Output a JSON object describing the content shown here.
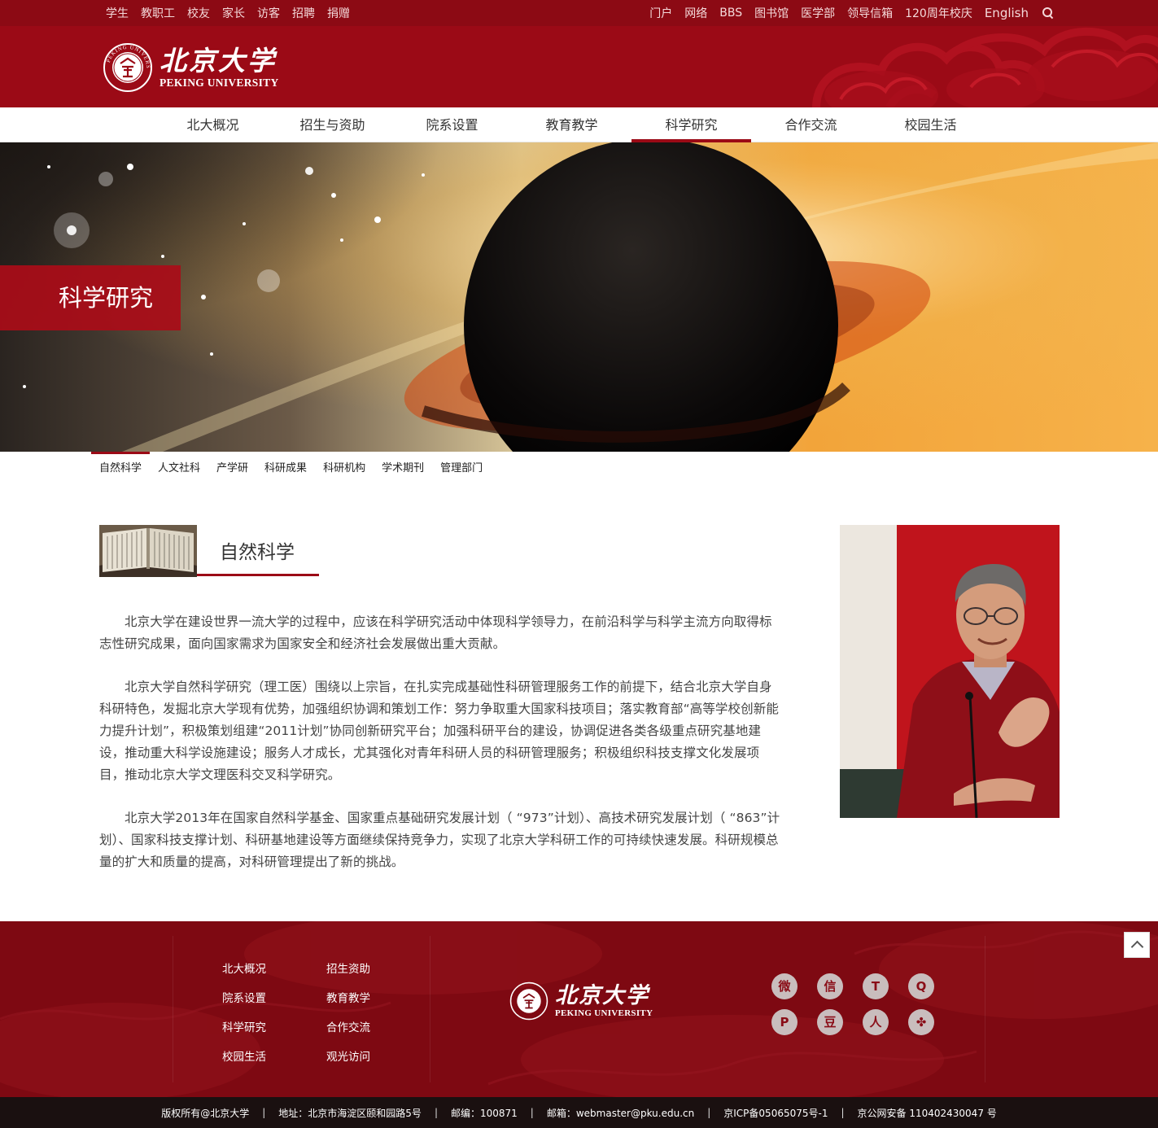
{
  "topbar": {
    "left_links": [
      "学生",
      "教职工",
      "校友",
      "家长",
      "访客",
      "招聘",
      "捐赠"
    ],
    "right_links": [
      "门户",
      "网络",
      "BBS",
      "图书馆",
      "医学部",
      "领导信箱",
      "120周年校庆",
      "English"
    ]
  },
  "logo": {
    "cn": "北京大学",
    "en": "PEKING UNIVERSITY"
  },
  "mainnav": {
    "items": [
      "北大概况",
      "招生与资助",
      "院系设置",
      "教育教学",
      "科学研究",
      "合作交流",
      "校园生活"
    ],
    "active": "科学研究"
  },
  "banner": {
    "title": "科学研究"
  },
  "subnav": {
    "items": [
      "自然科学",
      "人文社科",
      "产学研",
      "科研成果",
      "科研机构",
      "学术期刊",
      "管理部门"
    ],
    "active": "自然科学"
  },
  "section": {
    "title": "自然科学"
  },
  "article": {
    "paragraphs": [
      "北京大学在建设世界一流大学的过程中，应该在科学研究活动中体现科学领导力，在前沿科学与科学主流方向取得标志性研究成果，面向国家需求为国家安全和经济社会发展做出重大贡献。",
      "北京大学自然科学研究（理工医）围绕以上宗旨，在扎实完成基础性科研管理服务工作的前提下，结合北京大学自身科研特色，发掘北京大学现有优势，加强组织协调和策划工作：努力争取重大国家科技项目；落实教育部“高等学校创新能力提升计划”，积极策划组建“2011计划”协同创新研究平台；加强科研平台的建设，协调促进各类各级重点研究基地建设，推动重大科学设施建设；服务人才成长，尤其强化对青年科研人员的科研管理服务；积极组织科技支撑文化发展项目，推动北京大学文理医科交叉科学研究。",
      "北京大学2013年在国家自然科学基金、国家重点基础研究发展计划（ “973”计划）、高技术研究发展计划（ “863”计划）、国家科技支撑计划、科研基地建设等方面继续保持竞争力，实现了北京大学科研工作的可持续快速发展。科研规模总量的扩大和质量的提高，对科研管理提出了新的挑战。"
    ]
  },
  "footer": {
    "links": [
      "北大概况",
      "招生资助",
      "院系设置",
      "教育教学",
      "科学研究",
      "合作交流",
      "校园生活",
      "观光访问"
    ],
    "social_icons": [
      "weibo-icon",
      "wechat-icon",
      "tencent-weibo-icon",
      "qq-icon",
      "pinyin-icon",
      "douban-icon",
      "renren-icon",
      "clover-icon"
    ],
    "social_glyphs": [
      "微",
      "信",
      "T",
      "Q",
      "P",
      "豆",
      "人",
      "✤"
    ]
  },
  "copyright": {
    "items": [
      "版权所有@北京大学",
      "地址：北京市海淀区颐和园路5号",
      "邮编：100871",
      "邮箱：webmaster@pku.edu.cn",
      "京ICP备05065075号-1",
      "京公网安备 110402430047 号"
    ],
    "separator": "|"
  },
  "colors": {
    "brand_red": "#9b0a16",
    "topbar_red": "#8c0a14",
    "footer_red": "#7e0912",
    "copyright_bg": "#1a1010"
  }
}
